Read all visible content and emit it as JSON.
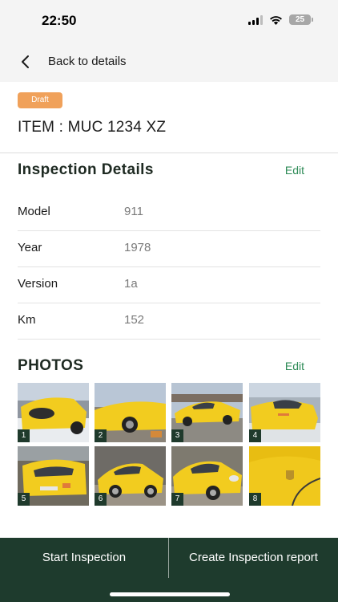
{
  "status_bar": {
    "time": "22:50",
    "battery": "25"
  },
  "nav": {
    "back_label": "Back to details"
  },
  "item": {
    "status_badge": "Draft",
    "title": "ITEM : MUC 1234 XZ"
  },
  "inspection_details": {
    "heading": "Inspection Details",
    "edit_label": "Edit",
    "rows": [
      {
        "label": "Model",
        "value": "911"
      },
      {
        "label": "Year",
        "value": "1978"
      },
      {
        "label": "Version",
        "value": "1a"
      },
      {
        "label": "Km",
        "value": "152"
      }
    ]
  },
  "photos": {
    "heading": "PHOTOS",
    "edit_label": "Edit",
    "items": [
      {
        "number": "1"
      },
      {
        "number": "2"
      },
      {
        "number": "3"
      },
      {
        "number": "4"
      },
      {
        "number": "5"
      },
      {
        "number": "6"
      },
      {
        "number": "7"
      },
      {
        "number": "8"
      }
    ]
  },
  "actions": {
    "start_label": "Start Inspection",
    "report_label": "Create Inspection report"
  },
  "colors": {
    "badge": "#f0a15a",
    "accent_green": "#2e8b57",
    "bottom_bar": "#1e3b2d",
    "car_yellow": "#f2cc1f"
  }
}
